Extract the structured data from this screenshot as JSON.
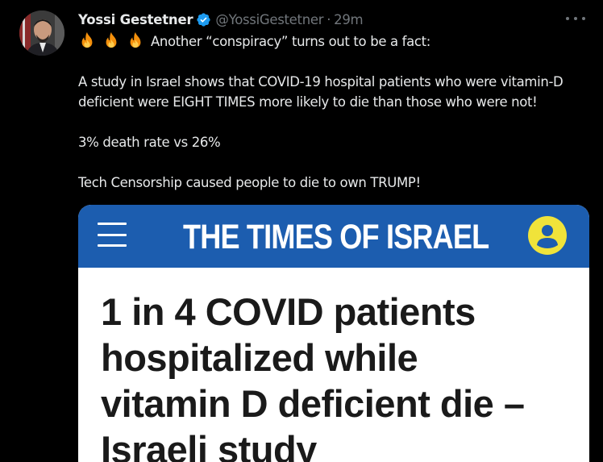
{
  "author": {
    "display_name": "Yossi Gestetner",
    "handle": "@YossiGestetner",
    "separator": "·",
    "time": "29m",
    "verified": true
  },
  "tweet": {
    "lines": [
      "Another “conspiracy” turns out to be a fact:",
      "A study in Israel shows that COVID-19 hospital patients who were vitamin-D",
      "deficient were EIGHT TIMES more likely to die than those who were not!",
      "3% death rate vs 26%",
      "Tech Censorship caused people to die to own TRUMP!"
    ],
    "emoji": [
      "fire-icon",
      "fire-icon",
      "fire-icon"
    ]
  },
  "card": {
    "brand": "THE TIMES OF ISRAEL",
    "headline_lines": [
      "1 in 4 COVID patients",
      "hospitalized while",
      "vitamin D deficient die –",
      "Israeli study"
    ]
  },
  "colors": {
    "background": "#000000",
    "text": "#e7e9ea",
    "muted": "#71767b",
    "verified": "#1d9bf0",
    "brand_bar": "#1c5daf",
    "brand_accent": "#f0e33a"
  }
}
